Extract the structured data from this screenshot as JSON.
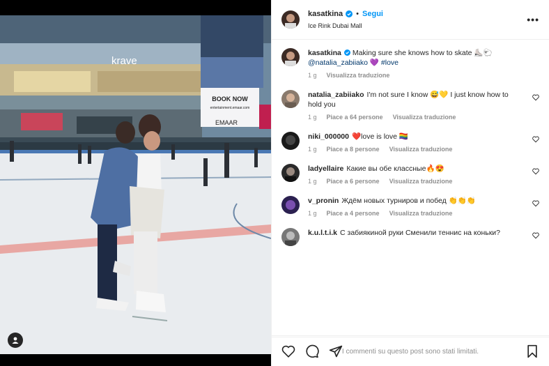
{
  "post": {
    "username": "kasatkina",
    "follow_label": "Segui",
    "dot": "•",
    "location": "Ice Rink Dubai Mall"
  },
  "photo": {
    "signs": {
      "krave": "krave",
      "book_now": "BOOK NOW",
      "book_url": "entertainment.emaar.com",
      "emaar": "EMAAR"
    }
  },
  "caption": {
    "username": "kasatkina",
    "text": "Making sure she knows how to skate ⛸️🐑",
    "mention": "@natalia_zabiiako",
    "emoji": "💜",
    "hashtag": "#love",
    "time": "1 g",
    "translate": "Visualizza traduzione"
  },
  "comments": [
    {
      "username": "natalia_zabiiako",
      "text": "I'm not sure I know 😅💛 I just know how to hold you",
      "time": "1 g",
      "likes": "Piace a 64 persone",
      "translate": "Visualizza traduzione"
    },
    {
      "username": "niki_000000",
      "text": "❤️love is love 🏳️‍🌈",
      "time": "1 g",
      "likes": "Piace a 8 persone",
      "translate": "Visualizza traduzione"
    },
    {
      "username": "ladyellaire",
      "text": "Какие вы обе классные🔥😍",
      "time": "1 g",
      "likes": "Piace a 6 persone",
      "translate": "Visualizza traduzione"
    },
    {
      "username": "v_pronin",
      "text": "Ждём новых турниров и побед 👏👏👏",
      "time": "1 g",
      "likes": "Piace a 4 persone",
      "translate": "Visualizza traduzione"
    },
    {
      "username": "k.u.l.t.i.k",
      "text": "С забиякиной руки Сменили теннис на коньки?",
      "time": "",
      "likes": "",
      "translate": ""
    }
  ],
  "footer": {
    "limited_text": "I commenti su questo post sono stati limitati."
  },
  "colors": {
    "follow": "#0095f6",
    "verified": "#0095f6",
    "link": "#00376b",
    "muted": "#8e8e8e"
  }
}
